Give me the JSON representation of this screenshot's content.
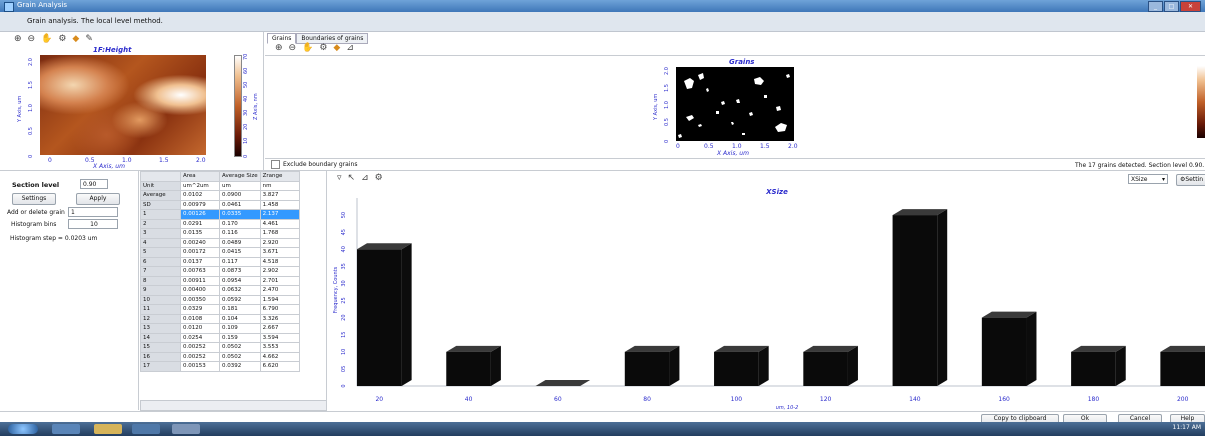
{
  "window": {
    "title": "Grain Analysis",
    "subtitle": "Grain analysis. The local level method."
  },
  "height_plot": {
    "title": "1F:Height",
    "x_ticks": [
      "0",
      "0.5",
      "1.0",
      "1.5",
      "2.0"
    ],
    "y_ticks": [
      "0",
      "0.5",
      "1.0",
      "1.5",
      "2.0"
    ],
    "xlabel": "X Axis, um",
    "ylabel": "Y Axis, um",
    "colorbar_ticks": [
      "0",
      "10",
      "20",
      "30",
      "40",
      "50",
      "60",
      "70"
    ],
    "colorbar_label": "Z Axis, nm"
  },
  "tabs": [
    "Grains",
    "Boundaries of grains"
  ],
  "grains_plot": {
    "title": "Grains",
    "x_ticks": [
      "0",
      "0.5",
      "1.0",
      "1.5",
      "2.0"
    ],
    "y_ticks": [
      "0",
      "0.5",
      "1.0",
      "1.5",
      "2.0"
    ],
    "xlabel": "X Axis, um",
    "ylabel": "Y Axis, um",
    "exclude_boundary_label": "Exclude boundary grains",
    "status_text": "The 17 grains detected. Section level 0.90."
  },
  "controls": {
    "section_level_label": "Section level",
    "section_level_value": "0.90",
    "settings_label": "Settings",
    "apply_label": "Apply",
    "add_delete_label": "Add or delete grain",
    "add_delete_value": "1",
    "histogram_bins_label": "Histogram bins",
    "histogram_bins_value": "10",
    "histogram_step_label": "Histogram step = 0.0203 um"
  },
  "table": {
    "columns": [
      "Area",
      "Average Size",
      "Zrange"
    ],
    "rows": [
      {
        "label": "Unit",
        "values": [
          "um^2um",
          "um",
          "nm"
        ]
      },
      {
        "label": "Average",
        "values": [
          "0.0102",
          "0.0900",
          "3.827"
        ]
      },
      {
        "label": "SD",
        "values": [
          "0.00979",
          "0.0461",
          "1.458"
        ]
      },
      {
        "label": "1",
        "values": [
          "0.00126",
          "0.0335",
          "2.137"
        ],
        "selected": true
      },
      {
        "label": "2",
        "values": [
          "0.0291",
          "0.170",
          "4.461"
        ]
      },
      {
        "label": "3",
        "values": [
          "0.0135",
          "0.116",
          "1.768"
        ]
      },
      {
        "label": "4",
        "values": [
          "0.00240",
          "0.0489",
          "2.920"
        ]
      },
      {
        "label": "5",
        "values": [
          "0.00172",
          "0.0415",
          "3.671"
        ]
      },
      {
        "label": "6",
        "values": [
          "0.0137",
          "0.117",
          "4.518"
        ]
      },
      {
        "label": "7",
        "values": [
          "0.00763",
          "0.0873",
          "2.902"
        ]
      },
      {
        "label": "8",
        "values": [
          "0.00911",
          "0.0954",
          "2.701"
        ]
      },
      {
        "label": "9",
        "values": [
          "0.00400",
          "0.0632",
          "2.470"
        ]
      },
      {
        "label": "10",
        "values": [
          "0.00350",
          "0.0592",
          "1.594"
        ]
      },
      {
        "label": "11",
        "values": [
          "0.0329",
          "0.181",
          "6.790"
        ]
      },
      {
        "label": "12",
        "values": [
          "0.0108",
          "0.104",
          "3.326"
        ]
      },
      {
        "label": "13",
        "values": [
          "0.0120",
          "0.109",
          "2.667"
        ]
      },
      {
        "label": "14",
        "values": [
          "0.0254",
          "0.159",
          "3.594"
        ]
      },
      {
        "label": "15",
        "values": [
          "0.00252",
          "0.0502",
          "3.553"
        ]
      },
      {
        "label": "16",
        "values": [
          "0.00252",
          "0.0502",
          "4.662"
        ]
      },
      {
        "label": "17",
        "values": [
          "0.00153",
          "0.0392",
          "6.620"
        ]
      }
    ]
  },
  "histogram_select": {
    "value": "XSize",
    "settings_label": "Settin"
  },
  "chart_data": {
    "type": "bar",
    "title": "XSize",
    "xlabel": "um, 10-2",
    "ylabel": "Frequency, Counts",
    "x_ticks": [
      "20",
      "40",
      "60",
      "80",
      "100",
      "120",
      "140",
      "160",
      "180",
      "200"
    ],
    "y_ticks": [
      "0",
      "05",
      "10",
      "15",
      "20",
      "25",
      "30",
      "35",
      "40",
      "45",
      "50"
    ],
    "xlim": [
      15,
      205
    ],
    "ylim": [
      0,
      55
    ],
    "bar_width": 10,
    "bars": [
      {
        "x": 20,
        "value": 40
      },
      {
        "x": 40,
        "value": 10
      },
      {
        "x": 60,
        "value": 0
      },
      {
        "x": 80,
        "value": 10
      },
      {
        "x": 100,
        "value": 10
      },
      {
        "x": 120,
        "value": 10
      },
      {
        "x": 140,
        "value": 50
      },
      {
        "x": 160,
        "value": 20
      },
      {
        "x": 180,
        "value": 10
      },
      {
        "x": 200,
        "value": 10
      }
    ]
  },
  "footer": {
    "copy_label": "Copy to clipboard",
    "ok_label": "Ok",
    "cancel_label": "Cancel",
    "help_label": "Help"
  },
  "taskbar": {
    "time": "11:17 AM"
  },
  "colors": {
    "accent": "#3399ff",
    "title": "#2b2bcc",
    "bar": "#0a0a0a"
  }
}
